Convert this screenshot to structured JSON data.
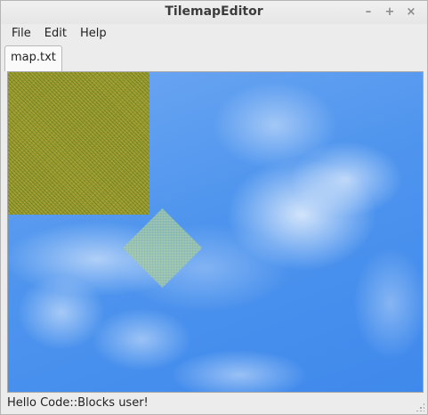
{
  "window": {
    "title": "TilemapEditor",
    "controls": {
      "minimize": "–",
      "maximize": "+",
      "close": "×"
    }
  },
  "menu": {
    "items": [
      {
        "label": "File"
      },
      {
        "label": "Edit"
      },
      {
        "label": "Help"
      }
    ]
  },
  "tabs": [
    {
      "label": "map.txt",
      "active": true
    }
  ],
  "canvas": {
    "background": "sky-clouds",
    "tiles": [
      "grass-tile",
      "rotated-tile"
    ]
  },
  "status": {
    "text": "Hello Code::Blocks user!"
  },
  "colors": {
    "sky": "#4f95ee",
    "grass": "#9c9a30",
    "window_bg": "#ececec"
  }
}
